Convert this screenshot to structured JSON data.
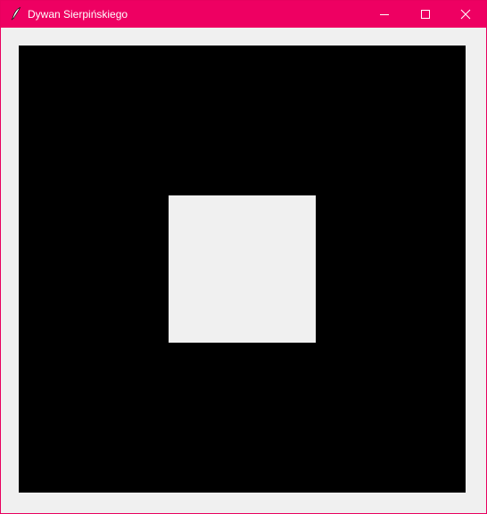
{
  "window": {
    "title": "Dywan Sierpińskiego",
    "app_icon": "feather-icon",
    "controls": [
      "minimize-icon",
      "maximize-icon",
      "close-icon"
    ]
  },
  "colors": {
    "titlebar": "#ee0062",
    "window_border": "#e8005f",
    "background": "#f0f0f0",
    "carpet": "#000000",
    "hole": "#f0f0f0"
  },
  "carpet": {
    "iteration": 1,
    "filled_squares": 8,
    "removed_squares": 1
  }
}
